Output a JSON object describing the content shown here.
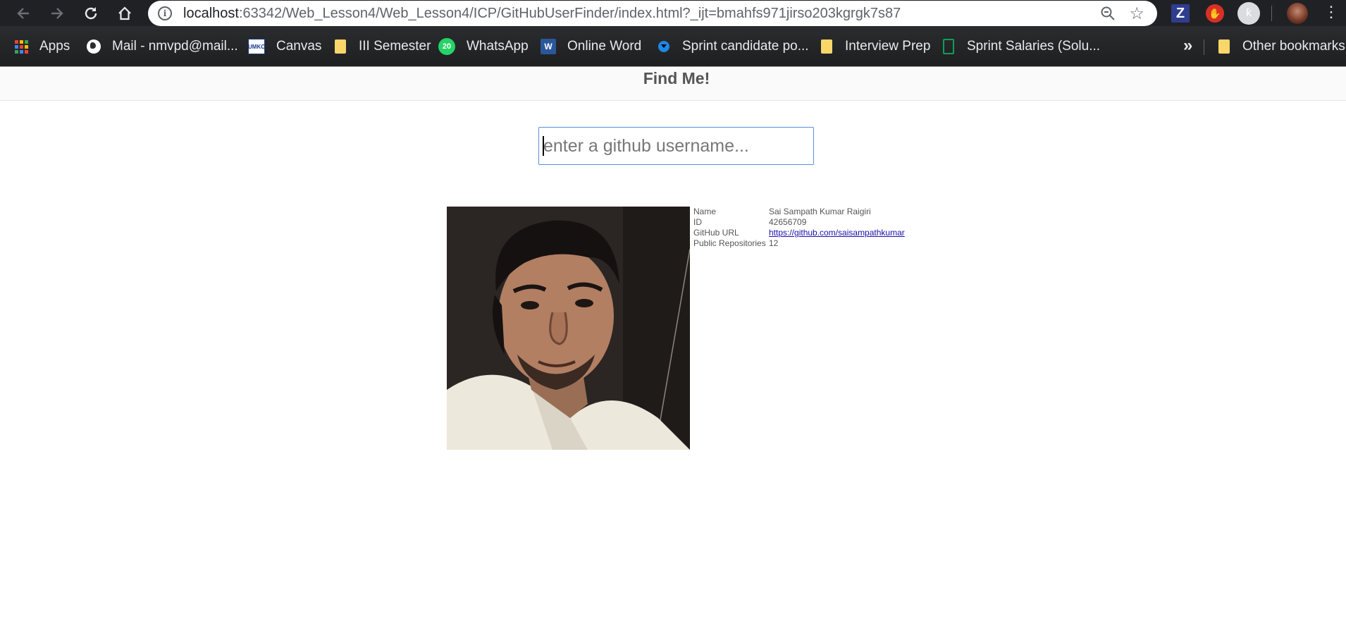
{
  "browser": {
    "url_host": "localhost",
    "url_rest": ":63342/Web_Lesson4/Web_Lesson4/ICP/GitHubUserFinder/index.html?_ijt=bmahfs971jirso203kgrgk7s87",
    "icons": {
      "back": "back-arrow-icon",
      "forward": "forward-arrow-icon",
      "reload": "reload-icon",
      "home": "home-icon",
      "info": "info-icon",
      "zoom": "zoom-icon",
      "star": "star-icon",
      "menu": "kebab-menu-icon"
    },
    "extensions": {
      "z_label": "Z"
    }
  },
  "bookmarks": {
    "items": [
      {
        "label": "Apps",
        "icon": "apps-grid-icon"
      },
      {
        "label": "Mail - nmvpd@mail...",
        "icon": "globe-icon"
      },
      {
        "label": "Canvas",
        "icon": "canvas-icon"
      },
      {
        "label": "III Semester",
        "icon": "folder-icon"
      },
      {
        "label": "WhatsApp",
        "icon": "whatsapp-icon",
        "badge": "20"
      },
      {
        "label": "Online Word",
        "icon": "word-icon"
      },
      {
        "label": "Sprint candidate po...",
        "icon": "sprint-icon"
      },
      {
        "label": "Interview Prep",
        "icon": "folder-icon"
      },
      {
        "label": "Sprint Salaries (Solu...",
        "icon": "sheets-icon"
      }
    ],
    "more": "»",
    "other": {
      "label": "Other bookmarks",
      "icon": "folder-icon"
    }
  },
  "page": {
    "title": "Find Me!",
    "search": {
      "placeholder": "enter a github username...",
      "value": ""
    },
    "user": {
      "rows": [
        {
          "label": "Name",
          "value": "Sai Sampath Kumar Raigiri"
        },
        {
          "label": "ID",
          "value": "42656709"
        },
        {
          "label": "GitHub URL",
          "value": "https://github.com/saisampathkumar"
        },
        {
          "label": "Public Repositories",
          "value": "12"
        }
      ]
    }
  },
  "colors": {
    "toolbar_bg": "#202124",
    "title_color": "#555555",
    "link_color": "#1a0dab",
    "input_border": "#5b8fd6"
  }
}
